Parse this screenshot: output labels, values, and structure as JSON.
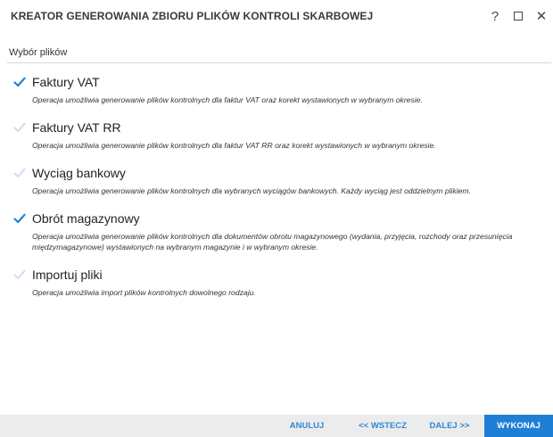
{
  "window": {
    "title": "KREATOR GENEROWANIA ZBIORU PLIKÓW KONTROLI SKARBOWEJ",
    "help_glyph": "?",
    "close_glyph": "✕"
  },
  "section": {
    "label": "Wybór plików"
  },
  "options": [
    {
      "label": "Faktury VAT",
      "checked": true,
      "description": "Operacja umożliwia generowanie plików kontrolnych dla faktur VAT oraz korekt wystawionych w wybranym okresie."
    },
    {
      "label": "Faktury VAT RR",
      "checked": false,
      "description": "Operacja umożliwia generowanie plików kontrolnych dla faktur VAT RR oraz korekt wystawionych w wybranym okresie."
    },
    {
      "label": "Wyciąg bankowy",
      "checked": false,
      "description": "Operacja umożliwia generowanie plików kontrolnych dla wybranych wyciągów bankowych. Każdy wyciąg jest oddzielnym plikiem."
    },
    {
      "label": "Obrót magazynowy",
      "checked": true,
      "description": "Operacja umożliwia generowanie plików kontrolnych dla dokumentów obrotu magazynowego (wydania, przyjęcia, rozchody oraz przesunięcia międzymagazynowe) wystawionych na wybranym magazynie i w wybranym okresie."
    },
    {
      "label": "Importuj pliki",
      "checked": false,
      "description": "Operacja umożliwia import plików kontrolnych dowolnego rodzaju."
    }
  ],
  "footer": {
    "cancel_label": "ANULUJ",
    "back_label": "<< WSTECZ",
    "next_label": "DALEJ >>",
    "execute_label": "WYKONAJ"
  },
  "colors": {
    "accent": "#1f7fd6",
    "check_active": "#1f7fd6",
    "check_inactive": "#cfe0f2",
    "footer_bg": "#ececec"
  },
  "icons": {
    "help": "help-icon",
    "maximize": "maximize-icon",
    "close": "close-icon",
    "check": "checkmark-icon"
  }
}
